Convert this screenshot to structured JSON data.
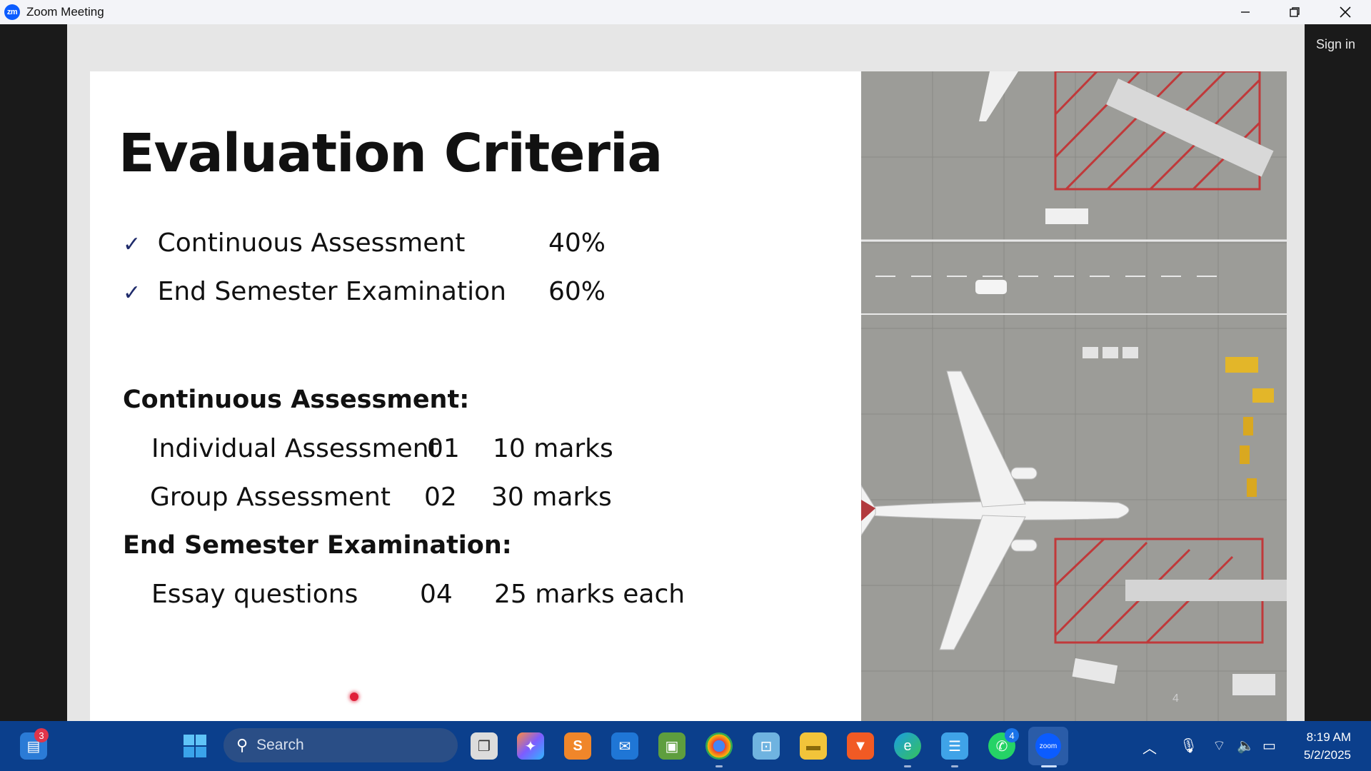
{
  "window": {
    "title": "Zoom Meeting",
    "icon_text": "zm"
  },
  "meeting": {
    "sign_in_label": "Sign in"
  },
  "slide": {
    "title": "Evaluation Criteria",
    "weights": [
      {
        "label": "Continuous Assessment",
        "value": "40%"
      },
      {
        "label": "End Semester Examination",
        "value": "60%"
      }
    ],
    "ca_heading": "Continuous Assessment:",
    "ca_items": [
      {
        "label": "Individual Assessment",
        "count": "01",
        "marks": "10 marks"
      },
      {
        "label": "Group Assessment",
        "count": "02",
        "marks": "30 marks"
      }
    ],
    "ese_heading": "End Semester Examination:",
    "ese_items": [
      {
        "label": "Essay questions",
        "count": "04",
        "marks": "25 marks each"
      }
    ],
    "page_number": "4"
  },
  "taskbar": {
    "search_label": "Search",
    "widgets_badge": "3",
    "whatsapp_badge": "4",
    "time": "8:19 AM",
    "date": "5/2/2025"
  }
}
